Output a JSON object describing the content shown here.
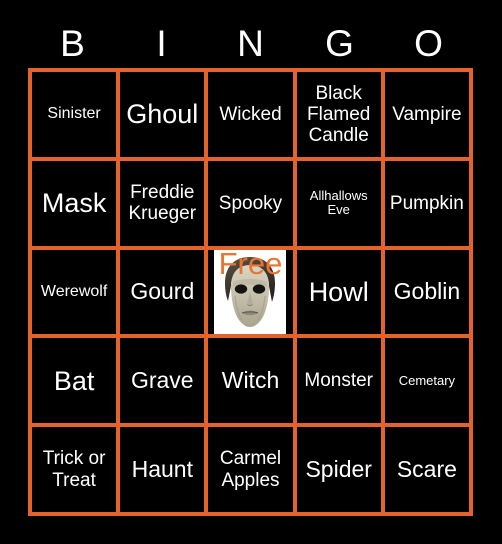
{
  "card": {
    "type": "bingo-card",
    "theme": "halloween",
    "background_color": "#000000",
    "grid_color": "#e4622b",
    "text_color": "#ffffff",
    "free_text_color": "#ea7430"
  },
  "header": {
    "letters": [
      "B",
      "I",
      "N",
      "G",
      "O"
    ]
  },
  "grid": {
    "rows": 5,
    "columns": 5,
    "cells": [
      {
        "label": "Sinister",
        "size": "sm"
      },
      {
        "label": "Ghoul",
        "size": "xl"
      },
      {
        "label": "Wicked",
        "size": "md"
      },
      {
        "label": "Black\nFlamed\nCandle",
        "size": "md"
      },
      {
        "label": "Vampire",
        "size": "md"
      },
      {
        "label": "Mask",
        "size": "xl"
      },
      {
        "label": "Freddie\nKrueger",
        "size": "md"
      },
      {
        "label": "Spooky",
        "size": "md"
      },
      {
        "label": "Allhallows\nEve",
        "size": "xs"
      },
      {
        "label": "Pumpkin",
        "size": "md"
      },
      {
        "label": "Werewolf",
        "size": "sm"
      },
      {
        "label": "Gourd",
        "size": "lg"
      },
      {
        "label": "Free",
        "size": "lg",
        "free": true,
        "image": "michael-myers-mask"
      },
      {
        "label": "Howl",
        "size": "xl"
      },
      {
        "label": "Goblin",
        "size": "lg"
      },
      {
        "label": "Bat",
        "size": "xl"
      },
      {
        "label": "Grave",
        "size": "lg"
      },
      {
        "label": "Witch",
        "size": "lg"
      },
      {
        "label": "Monster",
        "size": "md"
      },
      {
        "label": "Cemetary",
        "size": "xs"
      },
      {
        "label": "Trick or\nTreat",
        "size": "md"
      },
      {
        "label": "Haunt",
        "size": "lg"
      },
      {
        "label": "Carmel\nApples",
        "size": "md"
      },
      {
        "label": "Spider",
        "size": "lg"
      },
      {
        "label": "Scare",
        "size": "lg"
      }
    ]
  }
}
